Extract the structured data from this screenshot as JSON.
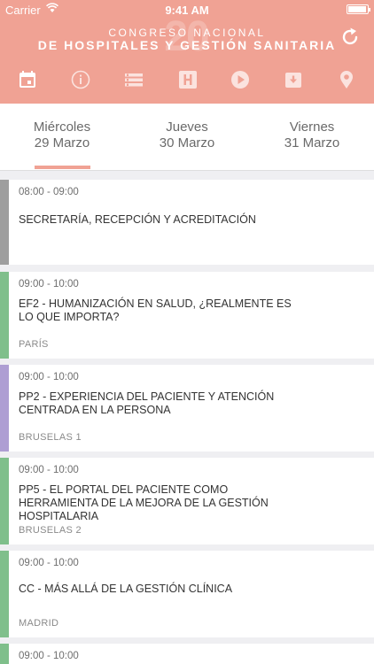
{
  "status_bar": {
    "carrier": "Carrier",
    "time": "9:41 AM"
  },
  "header": {
    "watermark": "20",
    "title_line1": "CONGRESO NACIONAL",
    "title_line2": "DE HOSPITALES Y GESTIÓN SANITARIA",
    "refresh_icon": "refresh-icon",
    "nav_icons": [
      "calendar-icon",
      "info-icon",
      "list-icon",
      "hospital-icon",
      "play-icon",
      "archive-icon",
      "location-icon"
    ]
  },
  "days": [
    {
      "name": "Miércoles",
      "date": "29 Marzo",
      "selected": true
    },
    {
      "name": "Jueves",
      "date": "30 Marzo",
      "selected": false
    },
    {
      "name": "Viernes",
      "date": "31 Marzo",
      "selected": false
    }
  ],
  "colors": {
    "header": "#f0a294",
    "gray": "#9e9e9e",
    "green": "#7fbf8b",
    "purple": "#ae9ed3"
  },
  "sessions": [
    {
      "time": "08:00 - 09:00",
      "title": "SECRETARÍA, RECEPCIÓN Y ACREDITACIÓN",
      "room": "",
      "color": "#9e9e9e"
    },
    {
      "time": "09:00 - 10:00",
      "title": "EF2 - HUMANIZACIÓN EN SALUD, ¿REALMENTE ES LO QUE IMPORTA?",
      "room": "PARÍS",
      "color": "#7fbf8b"
    },
    {
      "time": "09:00 - 10:00",
      "title": "PP2 - EXPERIENCIA DEL PACIENTE Y ATENCIÓN CENTRADA EN LA PERSONA",
      "room": "BRUSELAS 1",
      "color": "#ae9ed3"
    },
    {
      "time": "09:00 - 10:00",
      "title": "PP5 - EL PORTAL DEL PACIENTE COMO HERRAMIENTA DE LA MEJORA DE LA GESTIÓN HOSPITALARIA",
      "room": "BRUSELAS 2",
      "color": "#7fbf8b"
    },
    {
      "time": "09:00 - 10:00",
      "title": "CC - MÁS ALLÁ DE LA GESTIÓN CLÍNICA",
      "room": "MADRID",
      "color": "#7fbf8b"
    },
    {
      "time": "09:00 - 10:00",
      "title": "",
      "room": "",
      "color": "#7fbf8b"
    }
  ]
}
